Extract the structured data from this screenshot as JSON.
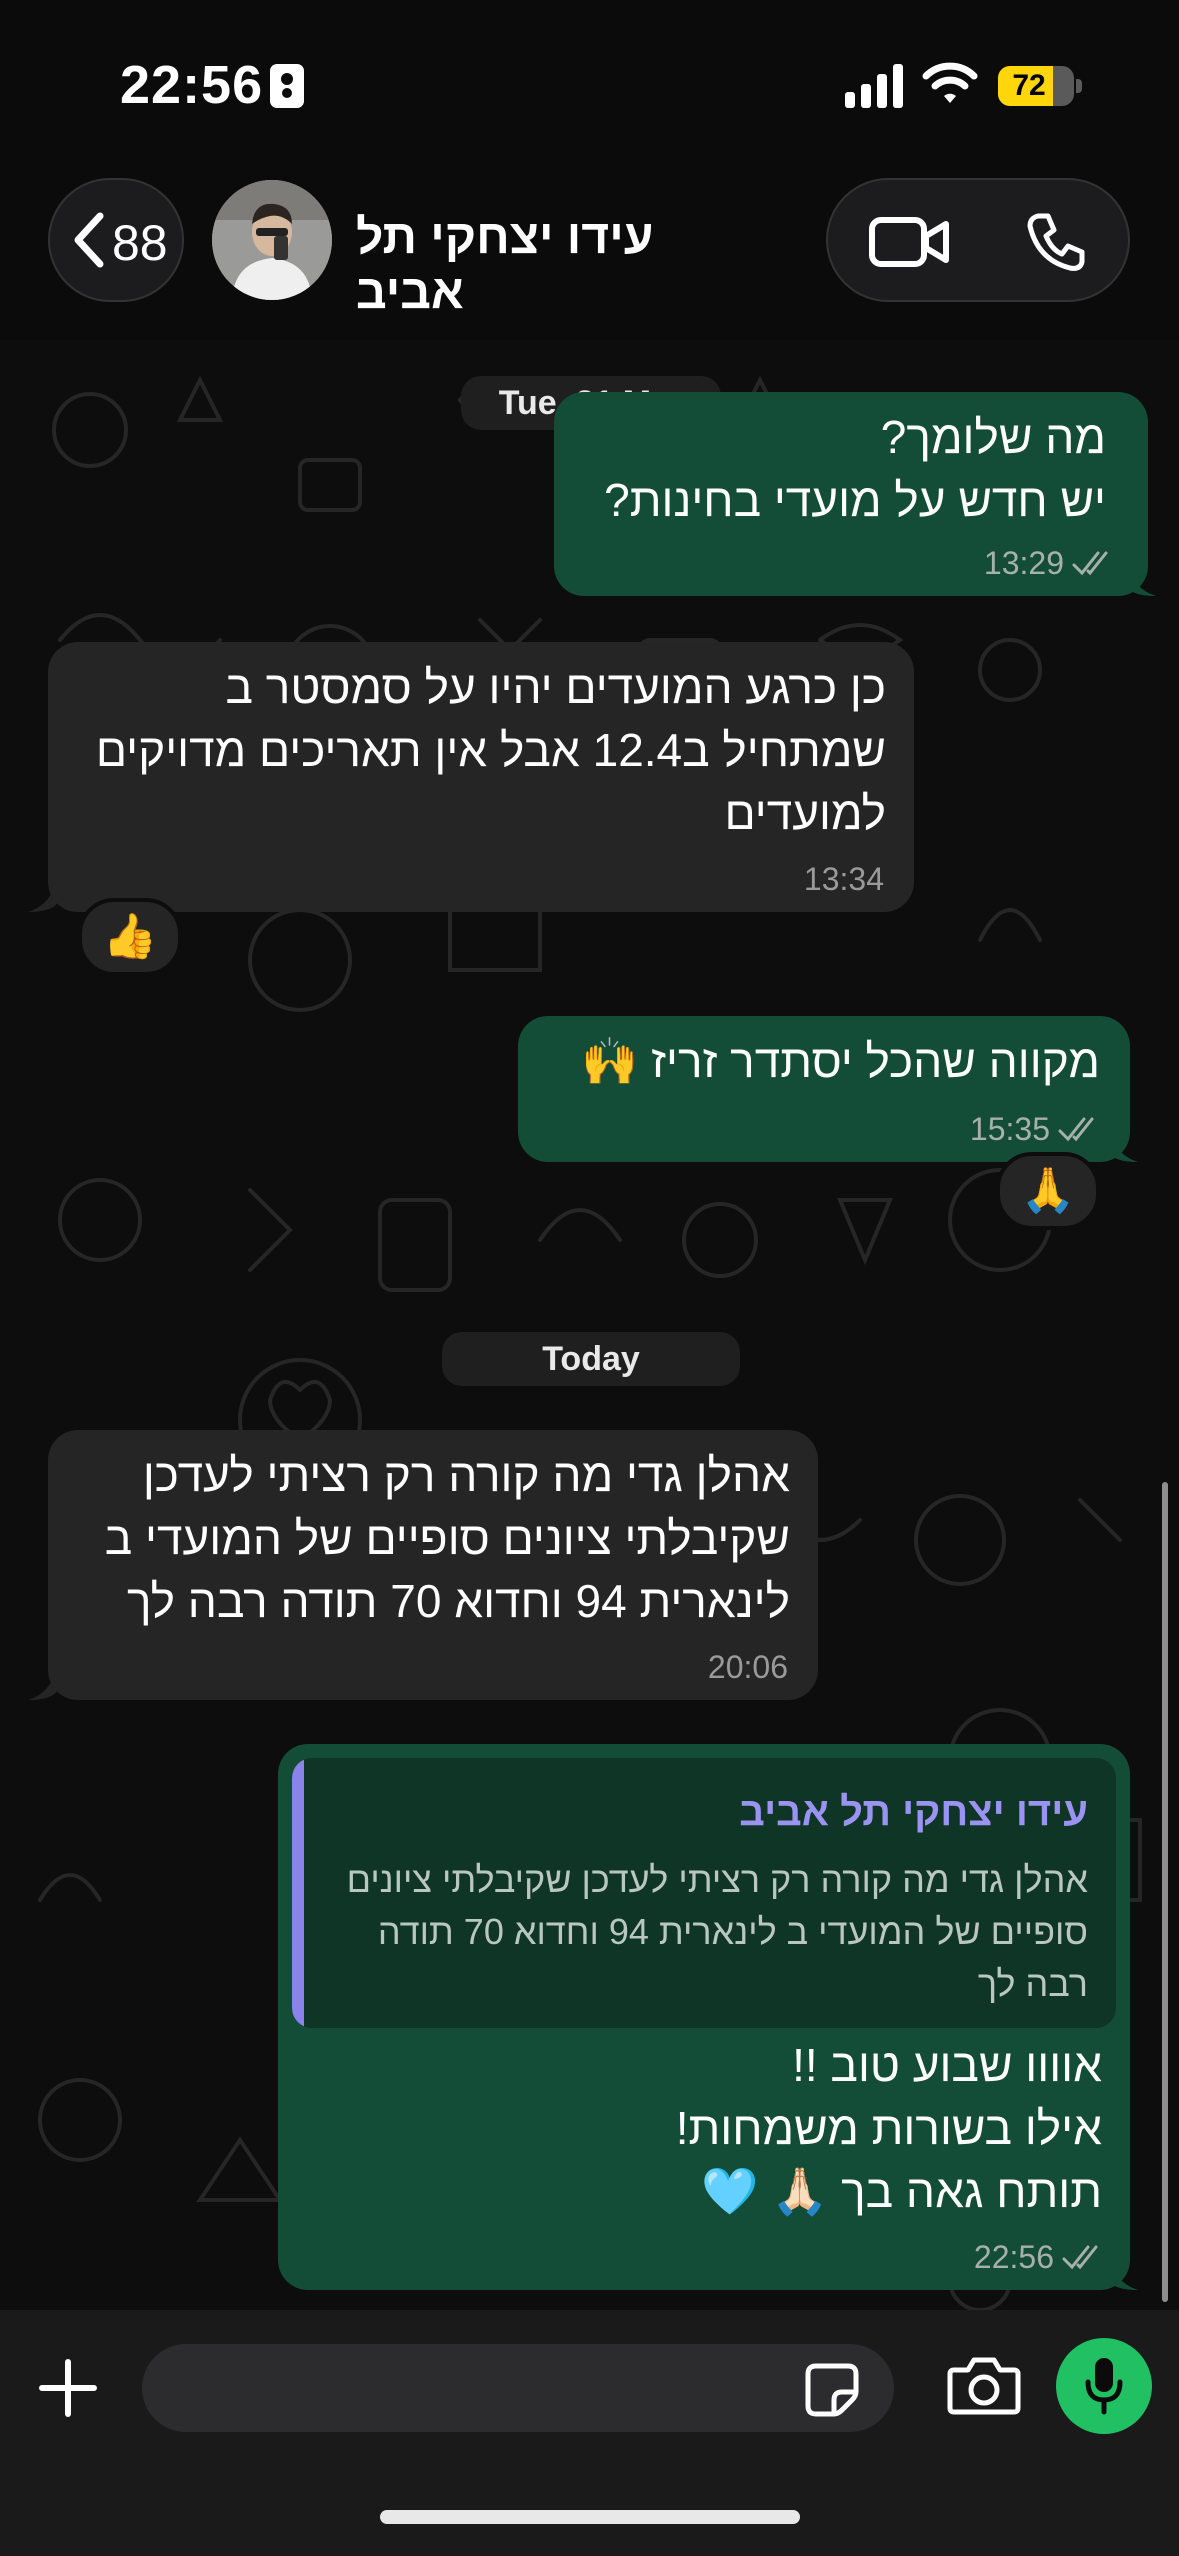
{
  "status": {
    "time": "22:56",
    "battery": "72",
    "battery_level": 0.72
  },
  "header": {
    "back_count": "88",
    "contact_name": "עידו יצחקי תל אביב"
  },
  "messages": [
    {
      "date": "Tue, 31 Mar"
    },
    {
      "dir": "out",
      "text": "מה שלומך?\nיש חדש על מועדי בחינות?",
      "time": "13:29"
    },
    {
      "dir": "in",
      "text": "כן כרגע המועדים יהיו על סמסטר ב שמתחיל ב12.4 אבל אין תאריכים מדויקים למועדים",
      "time": "13:34",
      "reaction": "👍"
    },
    {
      "dir": "out",
      "text": "מקווה שהכל יסתדר זריז 🙌",
      "time": "15:35",
      "reaction": "🙏"
    },
    {
      "date": "Today"
    },
    {
      "dir": "in",
      "text": "אהלן גדי מה קורה רק רציתי לעדכן שקיבלתי ציונים סופיים של המועדי ב לינארית 94 וחדוא 70 תודה רבה לך",
      "time": "20:06"
    },
    {
      "dir": "out",
      "reply_name": "עידו יצחקי תל אביב",
      "reply_text": "אהלן גדי מה קורה רק רציתי לעדכן שקיבלתי ציונים סופיים של המועדי ב לינארית 94 וחדוא 70 תודה רבה לך",
      "text": "אוווו שבוע טוב !!\nאילו בשורות משמחות!\nתותח גאה בך 🙏🏻 🩵",
      "time": "22:56"
    }
  ],
  "icons": {
    "back": "chevron-left-icon",
    "video": "video-camera-icon",
    "phone": "phone-icon",
    "plus": "plus-icon",
    "sticker": "sticker-icon",
    "camera": "camera-icon",
    "mic": "microphone-icon",
    "read_receipt": "double-check-icon"
  },
  "colors": {
    "outgoing": "#144d37",
    "incoming": "#252525",
    "accent": "#21c063",
    "reply_name": "#9a93f2"
  }
}
